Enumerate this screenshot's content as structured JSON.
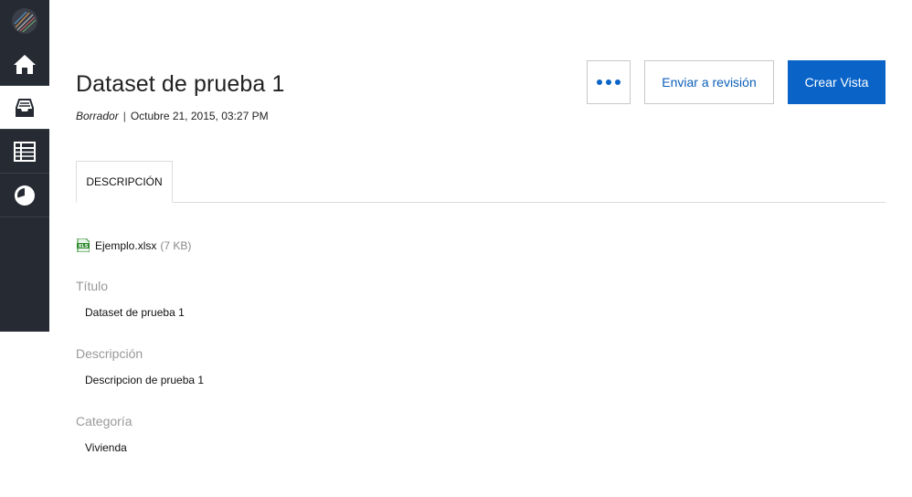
{
  "sidebar": {
    "items": [
      {
        "icon": "logo-icon"
      },
      {
        "icon": "home-icon"
      },
      {
        "icon": "datasets-inbox-icon",
        "active": true
      },
      {
        "icon": "table-icon"
      },
      {
        "icon": "pie-chart-icon"
      }
    ]
  },
  "header": {
    "title": "Dataset de prueba 1",
    "status": "Borrador",
    "separator": "|",
    "date": "Octubre 21, 2015, 03:27 PM"
  },
  "actions": {
    "more_icon": "more-dots-icon",
    "review_label": "Enviar a revisión",
    "create_label": "Crear Vista"
  },
  "tabs": [
    {
      "label": "DESCRIPCIÓN",
      "active": true
    }
  ],
  "file": {
    "icon": "xls-file-icon",
    "name": "Ejemplo.xlsx",
    "size": "(7 KB)"
  },
  "fields": [
    {
      "label": "Título",
      "value": "Dataset de prueba 1"
    },
    {
      "label": "Descripción",
      "value": "Descripcion de prueba 1"
    },
    {
      "label": "Categoría",
      "value": "Vivienda"
    }
  ],
  "colors": {
    "sidebar_bg": "#262a33",
    "primary": "#0a64c8",
    "file_icon": "#2e8b2e"
  }
}
